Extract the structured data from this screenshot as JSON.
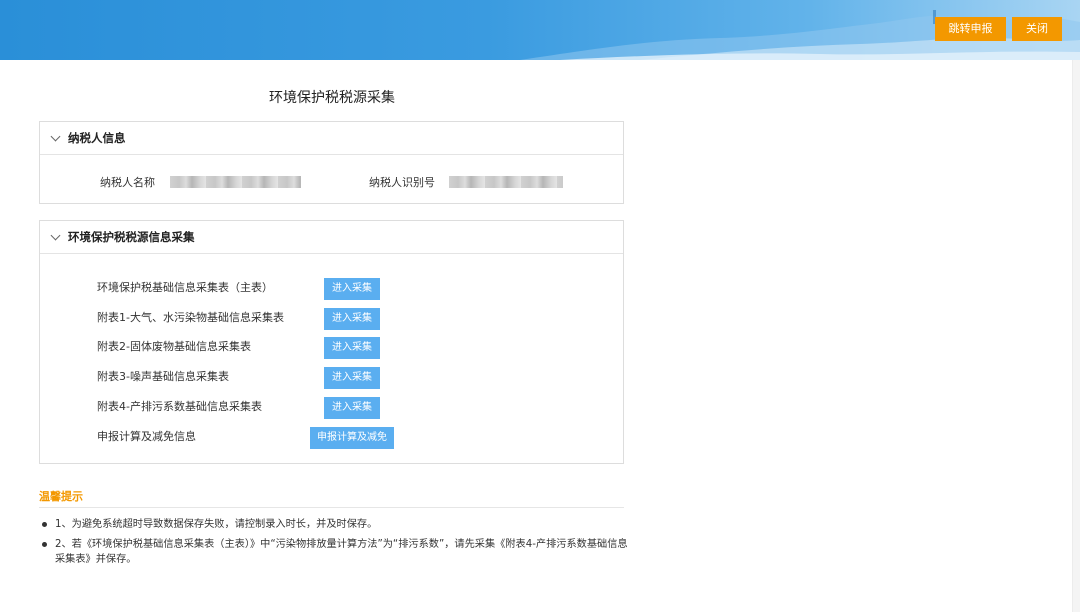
{
  "header": {
    "jump_button": "跳转申报",
    "close_button": "关闭",
    "banner_color": "#2a8fd8",
    "button_color": "#f39800"
  },
  "page": {
    "title": "环境保护税税源采集"
  },
  "taxpayer_panel": {
    "title": "纳税人信息",
    "name_label": "纳税人名称",
    "id_label": "纳税人识别号"
  },
  "collection_panel": {
    "title": "环境保护税税源信息采集",
    "button_color": "#5aaef0",
    "rows": [
      {
        "label": "环境保护税基础信息采集表（主表）",
        "button": "进入采集"
      },
      {
        "label": "附表1-大气、水污染物基础信息采集表",
        "button": "进入采集"
      },
      {
        "label": "附表2-固体废物基础信息采集表",
        "button": "进入采集"
      },
      {
        "label": "附表3-噪声基础信息采集表",
        "button": "进入采集"
      },
      {
        "label": "附表4-产排污系数基础信息采集表",
        "button": "进入采集"
      },
      {
        "label": "申报计算及减免信息",
        "button": "申报计算及减免"
      }
    ]
  },
  "tips": {
    "title": "温馨提示",
    "title_color": "#f39800",
    "items": [
      "1、为避免系统超时导致数据保存失败，请控制录入时长，并及时保存。",
      "2、若《环境保护税基础信息采集表（主表）》中“污染物排放量计算方法”为“排污系数”，请先采集《附表4-产排污系数基础信息采集表》并保存。"
    ]
  }
}
